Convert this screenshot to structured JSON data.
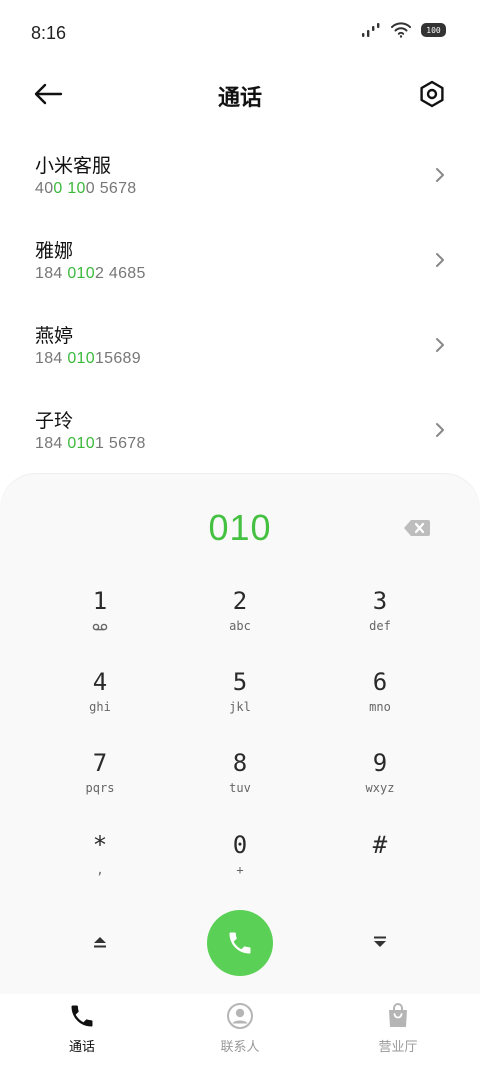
{
  "status_bar": {
    "time": "8:16",
    "battery": "100"
  },
  "header": {
    "title": "通话"
  },
  "contacts": [
    {
      "name": "小米客服",
      "number_parts": [
        {
          "t": "40",
          "hl": false
        },
        {
          "t": "0",
          "hl": true
        },
        {
          "t": " ",
          "hl": false
        },
        {
          "t": "10",
          "hl": true
        },
        {
          "t": "0 5678",
          "hl": false
        }
      ]
    },
    {
      "name": "雅娜",
      "number_parts": [
        {
          "t": "184 ",
          "hl": false
        },
        {
          "t": "010",
          "hl": true
        },
        {
          "t": "2 4685",
          "hl": false
        }
      ]
    },
    {
      "name": "燕婷",
      "number_parts": [
        {
          "t": "184 ",
          "hl": false
        },
        {
          "t": "010",
          "hl": true
        },
        {
          "t": "15689",
          "hl": false
        }
      ]
    },
    {
      "name": "子玲",
      "number_parts": [
        {
          "t": "184 ",
          "hl": false
        },
        {
          "t": "010",
          "hl": true
        },
        {
          "t": "1 5678",
          "hl": false
        }
      ]
    }
  ],
  "dialer": {
    "display": "010",
    "keys": [
      {
        "digit": "1",
        "sub": "",
        "sub_icon": "voicemail-icon"
      },
      {
        "digit": "2",
        "sub": "abc"
      },
      {
        "digit": "3",
        "sub": "def"
      },
      {
        "digit": "4",
        "sub": "ghi"
      },
      {
        "digit": "5",
        "sub": "jkl"
      },
      {
        "digit": "6",
        "sub": "mno"
      },
      {
        "digit": "7",
        "sub": "pqrs"
      },
      {
        "digit": "8",
        "sub": "tuv"
      },
      {
        "digit": "9",
        "sub": "wxyz"
      },
      {
        "digit": "*",
        "sub": ","
      },
      {
        "digit": "0",
        "sub": "+"
      },
      {
        "digit": "#",
        "sub": ""
      }
    ]
  },
  "nav": {
    "tabs": [
      {
        "label": "通话",
        "icon": "phone-icon",
        "active": true
      },
      {
        "label": "联系人",
        "icon": "person-icon",
        "active": false
      },
      {
        "label": "营业厅",
        "icon": "shopping-bag-icon",
        "active": false
      }
    ]
  },
  "colors": {
    "accent_green": "#45c142",
    "call_button": "#5bd057"
  }
}
